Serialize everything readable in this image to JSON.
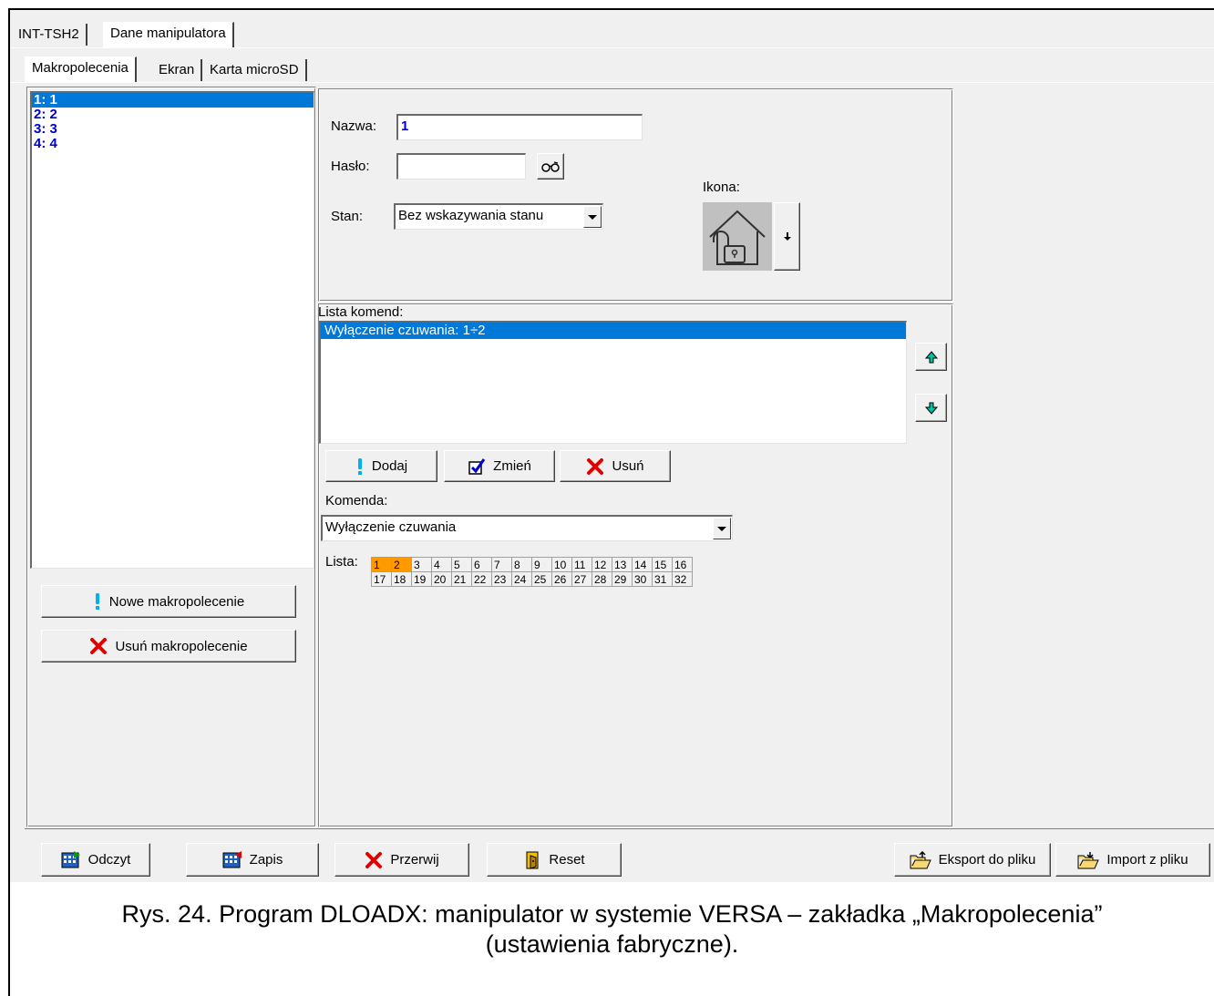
{
  "top_tabs": [
    {
      "label": "INT-TSH2",
      "active": false
    },
    {
      "label": "Dane manipulatora",
      "active": true
    }
  ],
  "sub_tabs": [
    {
      "label": "Makropolecenia",
      "active": true
    },
    {
      "label": "Ekran",
      "active": false
    },
    {
      "label": "Karta microSD",
      "active": false
    }
  ],
  "macro_list": {
    "items": [
      "1: 1",
      "2: 2",
      "3: 3",
      "4: 4"
    ],
    "selected_index": 0
  },
  "macro_buttons": {
    "new_label": "Nowe makropolecenie",
    "delete_label": "Usuń makropolecenie"
  },
  "form": {
    "name_label": "Nazwa:",
    "name_value": "1",
    "password_label": "Hasło:",
    "password_value": "",
    "state_label": "Stan:",
    "state_value": "Bez wskazywania stanu",
    "icon_label": "Ikona:"
  },
  "commands": {
    "list_label": "Lista komend:",
    "items": [
      "Wyłączenie czuwania: 1÷2"
    ],
    "selected_index": 0,
    "add_label": "Dodaj",
    "edit_label": "Zmień",
    "delete_label": "Usuń",
    "command_label": "Komenda:",
    "command_value": "Wyłączenie czuwania",
    "lista_label": "Lista:",
    "lista_row1": [
      "1",
      "2",
      "3",
      "4",
      "5",
      "6",
      "7",
      "8",
      "9",
      "10",
      "11",
      "12",
      "13",
      "14",
      "15",
      "16"
    ],
    "lista_row2": [
      "17",
      "18",
      "19",
      "20",
      "21",
      "22",
      "23",
      "24",
      "25",
      "26",
      "27",
      "28",
      "29",
      "30",
      "31",
      "32"
    ],
    "lista_selected": [
      "1",
      "2"
    ]
  },
  "bottom_buttons": {
    "read_label": "Odczyt",
    "write_label": "Zapis",
    "abort_label": "Przerwij",
    "reset_label": "Reset",
    "export_label": "Eksport do pliku",
    "import_label": "Import z pliku"
  },
  "caption": {
    "line1": "Rys. 24. Program DLOADX: manipulator w systemie VERSA – zakładka „Makropolecenia”",
    "line2": "(ustawienia fabryczne)."
  },
  "colors": {
    "selection": "#0078d7",
    "list_text": "#0000cc",
    "grid_selected": "#ff9900",
    "window_bg": "#f0f0f0"
  }
}
